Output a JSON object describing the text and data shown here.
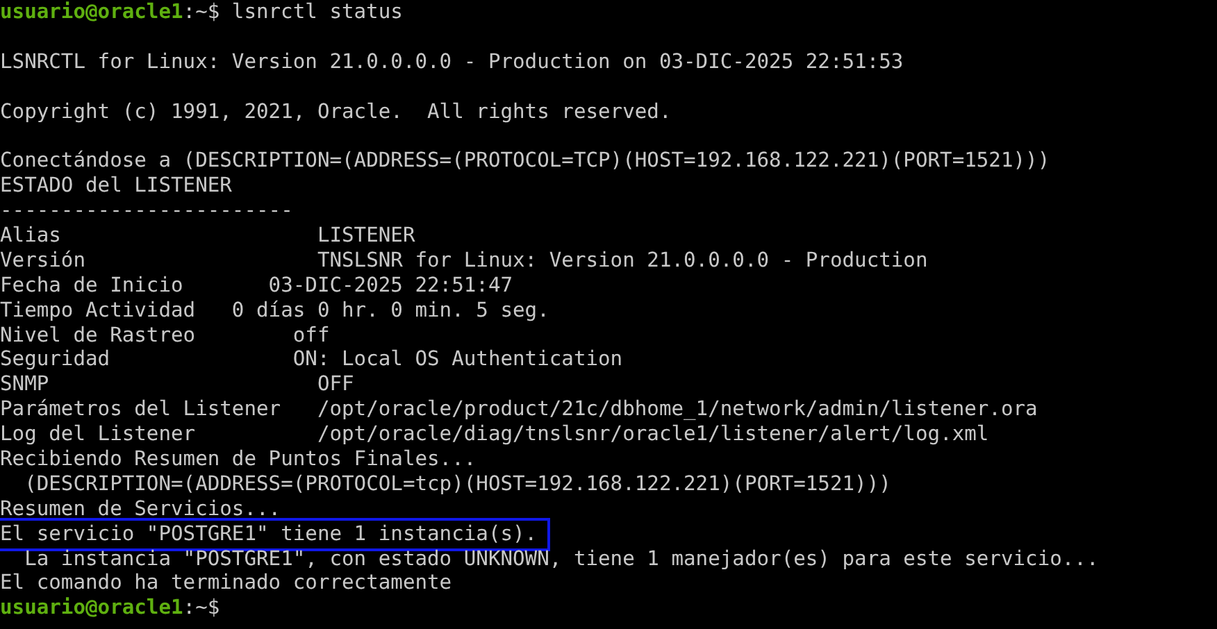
{
  "lines": [
    {
      "kind": "prompt",
      "user_host": "usuario@oracle1",
      "path": ":~$",
      "command": "lsnrctl status"
    },
    {
      "kind": "blank"
    },
    {
      "kind": "output",
      "text": "LSNRCTL for Linux: Version 21.0.0.0.0 - Production on 03-DIC-2025 22:51:53",
      "highlighted": false
    },
    {
      "kind": "blank"
    },
    {
      "kind": "output",
      "text": "Copyright (c) 1991, 2021, Oracle.  All rights reserved.",
      "highlighted": false
    },
    {
      "kind": "blank"
    },
    {
      "kind": "output",
      "text": "Conectándose a (DESCRIPTION=(ADDRESS=(PROTOCOL=TCP)(HOST=192.168.122.221)(PORT=1521)))",
      "highlighted": false
    },
    {
      "kind": "output",
      "text": "ESTADO del LISTENER",
      "highlighted": false
    },
    {
      "kind": "output",
      "text": "------------------------",
      "highlighted": false
    },
    {
      "kind": "output",
      "text": "Alias                     LISTENER",
      "highlighted": false
    },
    {
      "kind": "output",
      "text": "Versión                   TNSLSNR for Linux: Version 21.0.0.0.0 - Production",
      "highlighted": false
    },
    {
      "kind": "output",
      "text": "Fecha de Inicio       03-DIC-2025 22:51:47",
      "highlighted": false
    },
    {
      "kind": "output",
      "text": "Tiempo Actividad   0 días 0 hr. 0 min. 5 seg.",
      "highlighted": false
    },
    {
      "kind": "output",
      "text": "Nivel de Rastreo        off",
      "highlighted": false
    },
    {
      "kind": "output",
      "text": "Seguridad               ON: Local OS Authentication",
      "highlighted": false
    },
    {
      "kind": "output",
      "text": "SNMP                      OFF",
      "highlighted": false
    },
    {
      "kind": "output",
      "text": "Parámetros del Listener   /opt/oracle/product/21c/dbhome_1/network/admin/listener.ora",
      "highlighted": false
    },
    {
      "kind": "output",
      "text": "Log del Listener          /opt/oracle/diag/tnslsnr/oracle1/listener/alert/log.xml",
      "highlighted": false
    },
    {
      "kind": "output",
      "text": "Recibiendo Resumen de Puntos Finales...",
      "highlighted": false
    },
    {
      "kind": "output",
      "text": "  (DESCRIPTION=(ADDRESS=(PROTOCOL=tcp)(HOST=192.168.122.221)(PORT=1521)))",
      "highlighted": false
    },
    {
      "kind": "output",
      "text": "Resumen de Servicios...",
      "highlighted": false
    },
    {
      "kind": "output",
      "text": "El servicio \"POSTGRE1\" tiene 1 instancia(s).",
      "highlighted": true
    },
    {
      "kind": "output",
      "text": "  La instancia \"POSTGRE1\", con estado UNKNOWN, tiene 1 manejador(es) para este servicio...",
      "highlighted": false
    },
    {
      "kind": "output",
      "text": "El comando ha terminado correctamente",
      "highlighted": false
    },
    {
      "kind": "prompt",
      "user_host": "usuario@oracle1",
      "path": ":~$"
    }
  ]
}
